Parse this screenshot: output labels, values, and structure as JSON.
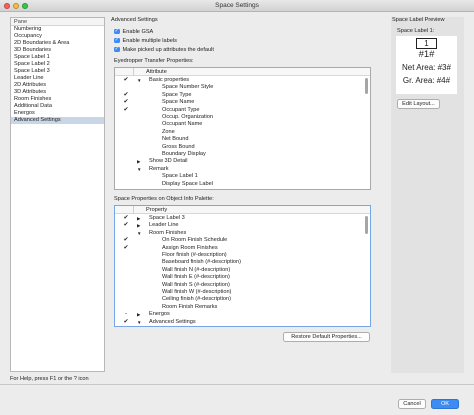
{
  "window": {
    "title": "Space Settings",
    "colors": {
      "close": "#fc605c",
      "minimize": "#fdbc40",
      "zoom": "#34c84a",
      "accent": "#3d8cf3",
      "selection": "#c9d6e8"
    }
  },
  "pane_list": {
    "header": "Pane",
    "items": [
      "Numbering",
      "Occupancy",
      "2D Boundaries & Area",
      "3D Boundaries",
      "Space Label 1",
      "Space Label 2",
      "Space Label 3",
      "Leader Line",
      "2D Attributes",
      "3D Attributes",
      "Room Finishes",
      "Additional Data",
      "Energos",
      "Advanced Settings"
    ],
    "selected_index": 13
  },
  "advanced": {
    "heading": "Advanced Settings",
    "checkboxes": [
      {
        "label": "Enable GSA",
        "checked": true
      },
      {
        "label": "Enable multiple labels",
        "checked": true
      },
      {
        "label": "Make picked up attributes the default",
        "checked": true
      }
    ],
    "eyedropper_heading": "Eyedropper Transfer Properties:",
    "eyedropper_column": "Attribute",
    "eyedropper_rows": [
      {
        "mark": "✔",
        "disclosure": "▼",
        "label": "Basic properties"
      },
      {
        "mark": "",
        "disclosure": "",
        "label": "Space Number Style"
      },
      {
        "mark": "✔",
        "disclosure": "",
        "label": "Space Type"
      },
      {
        "mark": "✔",
        "disclosure": "",
        "label": "Space Name"
      },
      {
        "mark": "✔",
        "disclosure": "",
        "label": "Occupant Type"
      },
      {
        "mark": "",
        "disclosure": "",
        "label": "Occup. Organization"
      },
      {
        "mark": "",
        "disclosure": "",
        "label": "Occupant Name"
      },
      {
        "mark": "",
        "disclosure": "",
        "label": "Zone"
      },
      {
        "mark": "",
        "disclosure": "",
        "label": "Net Bound"
      },
      {
        "mark": "",
        "disclosure": "",
        "label": "Gross Bound"
      },
      {
        "mark": "",
        "disclosure": "",
        "label": "Boundary Display"
      },
      {
        "mark": "",
        "disclosure": "▶",
        "label": "Show 3D Detail"
      },
      {
        "mark": "",
        "disclosure": "▼",
        "label": "Remark"
      },
      {
        "mark": "",
        "disclosure": "",
        "label": "Space Label 1"
      },
      {
        "mark": "",
        "disclosure": "",
        "label": "Display Space Label"
      }
    ],
    "oip_heading": "Space Properties on Object Info Palette:",
    "oip_column": "Property",
    "oip_rows": [
      {
        "mark": "✔",
        "disclosure": "▶",
        "label": "Space Label 3"
      },
      {
        "mark": "✔",
        "disclosure": "▶",
        "label": "Leader Line"
      },
      {
        "mark": "",
        "disclosure": "▼",
        "label": "Room Finishes"
      },
      {
        "mark": "✔",
        "disclosure": "",
        "label": "On Room Finish Schedule"
      },
      {
        "mark": "✔",
        "disclosure": "",
        "label": "Assign Room Finishes"
      },
      {
        "mark": "",
        "disclosure": "",
        "label": "Floor finish (#-description)"
      },
      {
        "mark": "",
        "disclosure": "",
        "label": "Baseboard finish (#-description)"
      },
      {
        "mark": "",
        "disclosure": "",
        "label": "Wall finish N (#-description)"
      },
      {
        "mark": "",
        "disclosure": "",
        "label": "Wall finish E (#-description)"
      },
      {
        "mark": "",
        "disclosure": "",
        "label": "Wall finish S (#-description)"
      },
      {
        "mark": "",
        "disclosure": "",
        "label": "Wall finish W (#-description)"
      },
      {
        "mark": "",
        "disclosure": "",
        "label": "Ceiling finish (#-description)"
      },
      {
        "mark": "",
        "disclosure": "",
        "label": "Room Finish Remarks"
      },
      {
        "mark": "-",
        "disclosure": "▶",
        "label": "Energos"
      },
      {
        "mark": "✔",
        "disclosure": "▼",
        "label": "Advanced Settings"
      }
    ],
    "restore_button": "Restore Default Properties..."
  },
  "preview": {
    "heading": "Space Label Preview",
    "label_title": "Space Label 1:",
    "lines": [
      "1",
      "#1#",
      "Net Area: #3#",
      "Gr. Area: #4#"
    ],
    "edit_button": "Edit Layout..."
  },
  "status": {
    "help_text": "For Help, press F1 or the ? icon"
  },
  "footer": {
    "cancel": "Cancel",
    "ok": "OK"
  }
}
